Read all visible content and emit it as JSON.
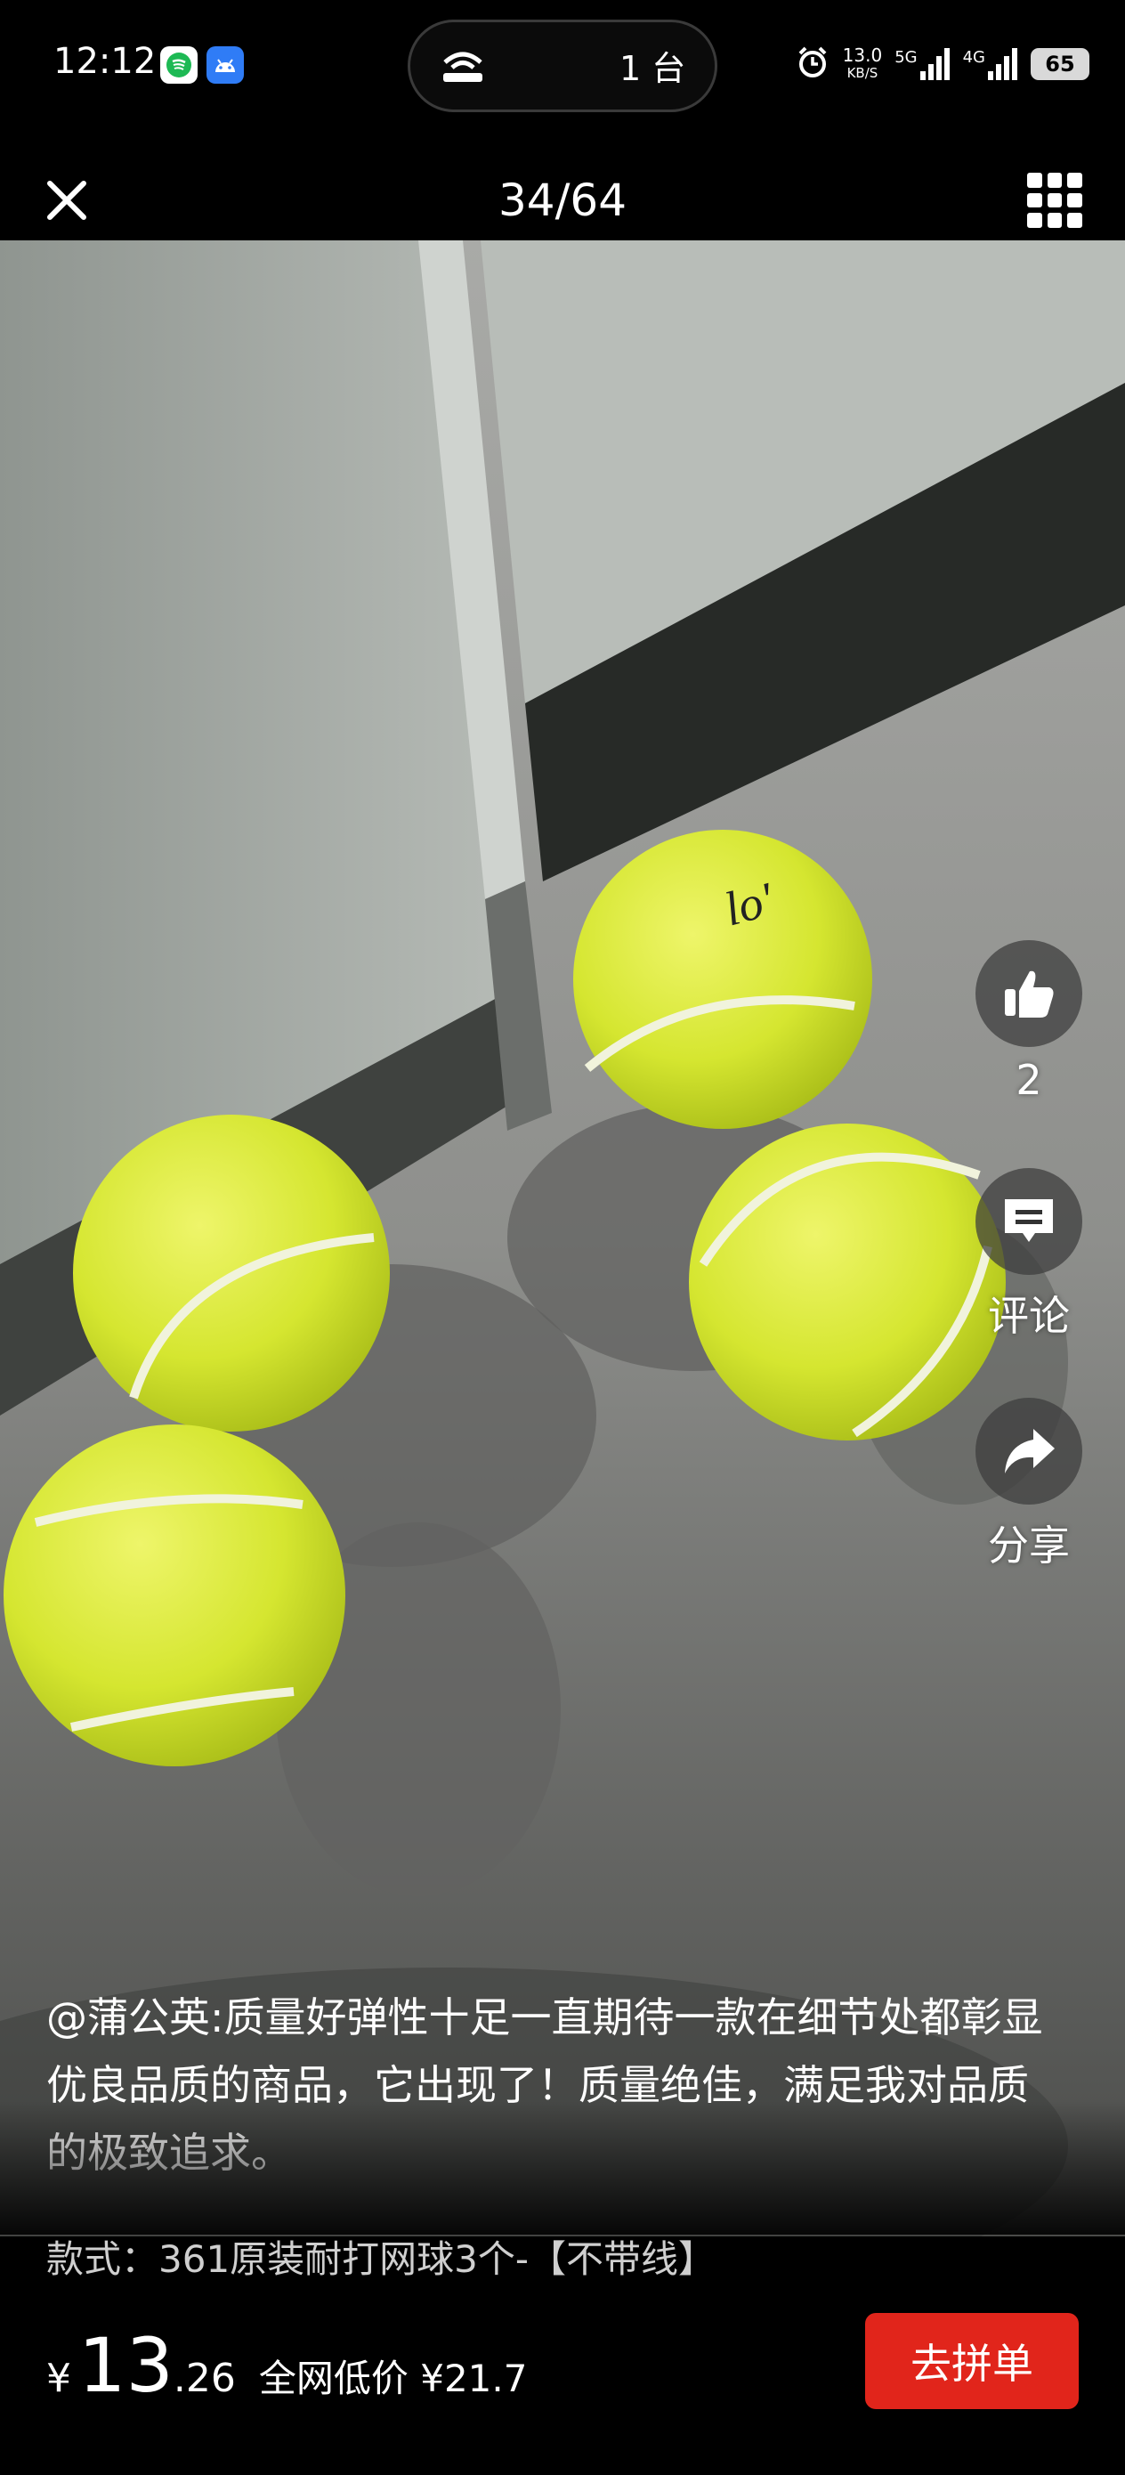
{
  "status_bar": {
    "time": "12:12",
    "island_count": "1 台",
    "net_speed_value": "13.0",
    "net_speed_unit": "KB/S",
    "signal_1": "5G",
    "signal_2": "4G",
    "battery": "65"
  },
  "top_bar": {
    "counter": "34/64"
  },
  "actions": {
    "like_count": "2",
    "comment_label": "评论",
    "share_label": "分享"
  },
  "review": {
    "text": "@蒲公英:质量好弹性十足一直期待一款在细节处都彰显优良品质的商品，它出现了！质量绝佳，满足我对品质的极致追求。"
  },
  "product": {
    "variant": "款式：361原装耐打网球3个-【不带线】",
    "currency": "¥",
    "price_int": "13",
    "price_dec": ".26",
    "lowest_label": "全网低价 ¥21.7",
    "buy_label": "去拼单"
  },
  "colors": {
    "buy_button": "#e1251b",
    "tennis_ball": "#dfee3a"
  }
}
